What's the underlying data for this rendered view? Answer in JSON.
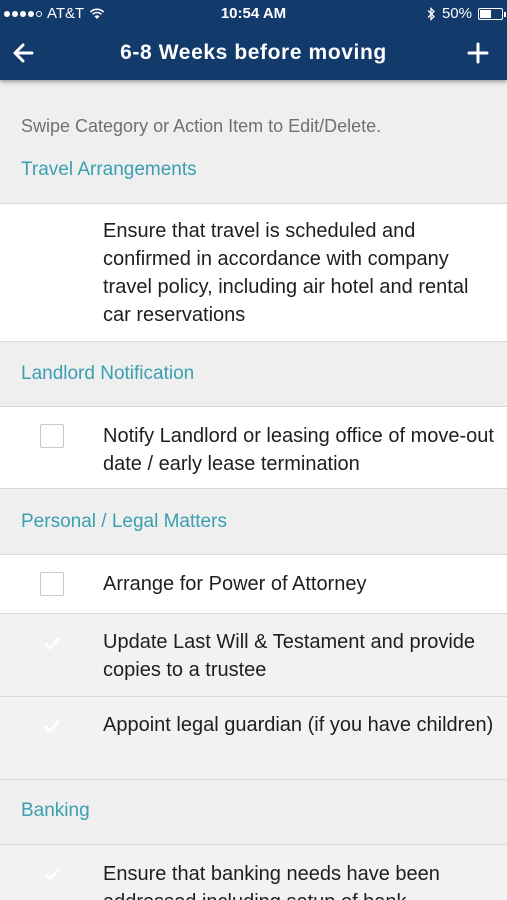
{
  "status_bar": {
    "carrier": "AT&T",
    "time": "10:54 AM",
    "battery": "50%",
    "battery_level": 0.5,
    "icons": [
      "signal-dots-icon",
      "wifi-icon",
      "bluetooth-icon",
      "battery-icon"
    ]
  },
  "nav": {
    "title": "6-8 Weeks before moving",
    "back_icon": "back-arrow-icon",
    "add_icon": "plus-icon"
  },
  "hint": "Swipe Category or Action Item to Edit/Delete.",
  "colors": {
    "header_bg": "#123a6b",
    "section_title": "#3a9fb0",
    "checkbox_checked": "#123a6b"
  },
  "categories": [
    {
      "title": "Travel Arrangements",
      "items": [
        {
          "text": "Ensure that travel is scheduled and confirmed in accordance with company travel policy, including air hotel and rental car reservations",
          "checked": true
        }
      ]
    },
    {
      "title": "Landlord Notification",
      "items": [
        {
          "text": "Notify Landlord or leasing office of move-out date / early lease termination",
          "checked": false
        }
      ]
    },
    {
      "title": "Personal / Legal Matters",
      "items": [
        {
          "text": "Arrange for Power of Attorney",
          "checked": false
        },
        {
          "text": "Update Last Will & Testament and provide copies to a trustee",
          "checked": true
        },
        {
          "text": "Appoint legal guardian (if you have children)",
          "checked": true
        }
      ]
    },
    {
      "title": "Banking",
      "items": [
        {
          "text": "Ensure that banking needs have been addressed including setup of bank",
          "checked": true
        }
      ]
    }
  ]
}
